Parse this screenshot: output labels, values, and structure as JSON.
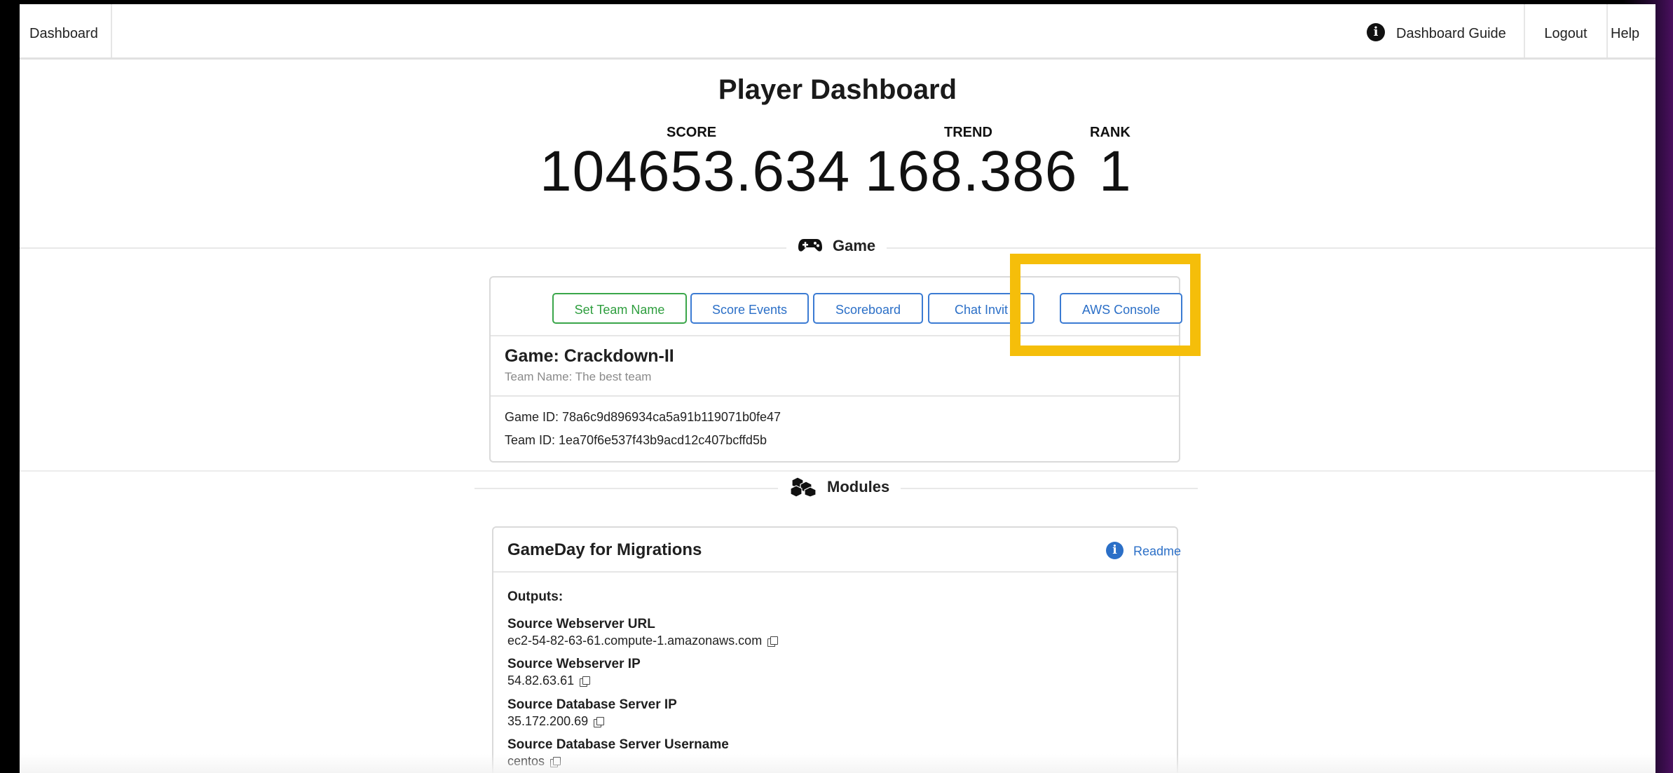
{
  "nav": {
    "dashboard": "Dashboard",
    "guide": "Dashboard Guide",
    "logout": "Logout",
    "help": "Help",
    "guide_icon": "info-circle-icon"
  },
  "header": {
    "title": "Player Dashboard",
    "score_label": "SCORE",
    "score_value": "104653.634",
    "trend_label": "TREND",
    "trend_value": "168.386",
    "rank_label": "RANK",
    "rank_value": "1"
  },
  "game_section": {
    "title": "Game",
    "icon": "gamepad-icon",
    "buttons": {
      "set_team_name": "Set Team Name",
      "score_events": "Score Events",
      "scoreboard": "Scoreboard",
      "chat_invite": "Chat Invit",
      "aws_console": "AWS Console"
    },
    "game_title": "Game: Crackdown-II",
    "team_name": "Team Name: The best team",
    "game_id": "Game ID: 78a6c9d896934ca5a91b119071b0fe47",
    "team_id": "Team ID: 1ea70f6e537f43b9acd12c407bcffd5b",
    "highlight_color": "#f5be0a"
  },
  "modules_section": {
    "title": "Modules",
    "icon": "cubes-icon",
    "module_title": "GameDay for Migrations",
    "readme": "Readme",
    "outputs_label": "Outputs:",
    "outputs": [
      {
        "label": "Source Webserver URL",
        "value": "ec2-54-82-63-61.compute-1.amazonaws.com"
      },
      {
        "label": "Source Webserver IP",
        "value": "54.82.63.61"
      },
      {
        "label": "Source Database Server IP",
        "value": "35.172.200.69"
      },
      {
        "label": "Source Database Server Username",
        "value": "centos"
      }
    ]
  },
  "colors": {
    "green": "#2e9e3e",
    "blue": "#2b6fc7"
  }
}
